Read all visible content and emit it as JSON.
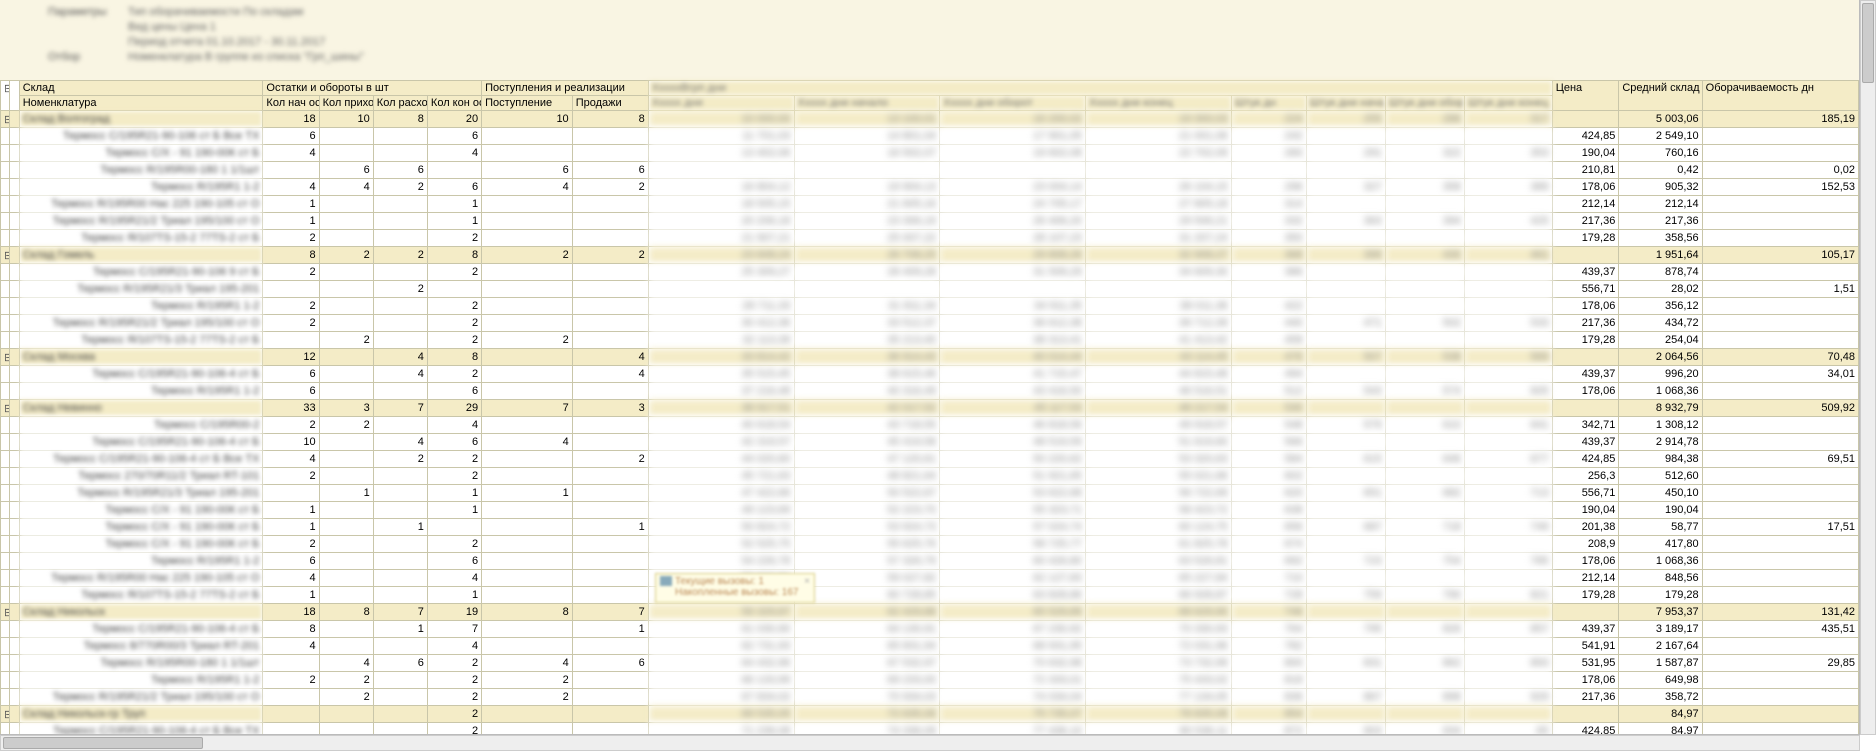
{
  "meta": {
    "p1_label": "Параметры",
    "p1a": "Тип оборачиваемости По складам",
    "p1b": "Вид цены Цена 1",
    "p1c": "Период отчета 01.10.2017 - 30.11.2017",
    "p2_label": "Отбор",
    "p2a": "Номенклатура В группе из списка \"Грп_шины\""
  },
  "headers": {
    "warehouse": "Склад",
    "balances_group": "Остатки и обороты в шт",
    "receipts_group": "Поступления и реализации",
    "blank_group": "XxxxxВгрп дни",
    "price": "Цена",
    "avg_stock": "Средний склад",
    "turnover": "Оборачиваемость дн",
    "nomenclature": "Номенклатура",
    "q_start": "Кол нач ост",
    "q_in": "Кол приход",
    "q_out": "Кол расход",
    "q_end": "Кол кон ост",
    "receipt": "Поступление",
    "sales": "Продажи",
    "bh1": "Xxxxx дни",
    "bh2": "Xxxxx дни начало",
    "bh3": "Xxxxx дни оборот",
    "bh4": "Xxxxx дни конец",
    "bs1": "Штук дн",
    "bs2": "Штук дни начало",
    "bs3": "Штук дни оборот",
    "bs4": "Штук дни конец"
  },
  "popup": {
    "line1": "Текущие вызовы: 1",
    "line2": "Накопленные вызовы: 167"
  },
  "toggle": {
    "open": "⊟",
    "closed": "⊞"
  },
  "rows": [
    {
      "t": "g",
      "tog": "⊟",
      "nom": "Склад Волгоград",
      "q": [
        "18",
        "10",
        "8",
        "20",
        "10",
        "8"
      ],
      "p": "",
      "a": "5 003,06",
      "tn": "185,19"
    },
    {
      "t": "d",
      "nom": "Термосс С/195R21-90-106 ст Б Все ТХ",
      "q": [
        "6",
        "",
        "",
        "6",
        "",
        ""
      ],
      "p": "424,85",
      "a": "2 549,10",
      "tn": ""
    },
    {
      "t": "d",
      "nom": "Термосс С/Х - 91 190-00К ст Б",
      "q": [
        "4",
        "",
        "",
        "4",
        "",
        ""
      ],
      "p": "190,04",
      "a": "760,16",
      "tn": ""
    },
    {
      "t": "d",
      "nom": "Термосс R/195R00-180 1 1/1шт",
      "q": [
        "",
        "6",
        "6",
        "",
        "6",
        "6"
      ],
      "p": "210,81",
      "a": "0,42",
      "tn": "0,02"
    },
    {
      "t": "d",
      "nom": "Термосс R/195R1 1-2",
      "q": [
        "4",
        "4",
        "2",
        "6",
        "4",
        "2"
      ],
      "p": "178,06",
      "a": "905,32",
      "tn": "152,53"
    },
    {
      "t": "d",
      "nom": "Термосс R/195R00 Нас 225 190-105 ст О",
      "q": [
        "1",
        "",
        "",
        "1",
        "",
        ""
      ],
      "p": "212,14",
      "a": "212,14",
      "tn": ""
    },
    {
      "t": "d",
      "nom": "Термосс R/195R21/2 Триал 195/100 ст О",
      "q": [
        "1",
        "",
        "",
        "1",
        "",
        ""
      ],
      "p": "217,36",
      "a": "217,36",
      "tn": ""
    },
    {
      "t": "d",
      "nom": "Термосс Я/107TS-15-2 77TS-2 ст Б",
      "q": [
        "2",
        "",
        "",
        "2",
        "",
        ""
      ],
      "p": "179,28",
      "a": "358,56",
      "tn": ""
    },
    {
      "t": "g",
      "tog": "⊟",
      "nom": "Склад Гомель",
      "q": [
        "8",
        "2",
        "2",
        "8",
        "2",
        "2"
      ],
      "p": "",
      "a": "1 951,64",
      "tn": "105,17"
    },
    {
      "t": "d",
      "nom": "Термосс С/195R21-90-106 9 ст Б",
      "q": [
        "2",
        "",
        "",
        "2",
        "",
        ""
      ],
      "p": "439,37",
      "a": "878,74",
      "tn": ""
    },
    {
      "t": "d",
      "nom": "Термосс R/195R21/3 Триал 195-201",
      "q": [
        "",
        "",
        "2",
        "",
        "",
        ""
      ],
      "p": "556,71",
      "a": "28,02",
      "tn": "1,51"
    },
    {
      "t": "d",
      "nom": "Термосс R/195R1 1-2",
      "q": [
        "2",
        "",
        "",
        "2",
        "",
        ""
      ],
      "p": "178,06",
      "a": "356,12",
      "tn": ""
    },
    {
      "t": "d",
      "nom": "Термосс R/195R21/2 Триал 195/100 ст О",
      "q": [
        "2",
        "",
        "",
        "2",
        "",
        ""
      ],
      "p": "217,36",
      "a": "434,72",
      "tn": ""
    },
    {
      "t": "d",
      "nom": "Термосс Я/107TS-15-2 77TS-2 ст Б",
      "q": [
        "",
        "2",
        "",
        "2",
        "2",
        ""
      ],
      "p": "179,28",
      "a": "254,04",
      "tn": ""
    },
    {
      "t": "g",
      "tog": "⊟",
      "nom": "Склад Москва",
      "q": [
        "12",
        "",
        "4",
        "8",
        "",
        "4"
      ],
      "p": "",
      "a": "2 064,56",
      "tn": "70,48"
    },
    {
      "t": "d",
      "nom": "Термосс С/195R21-90-106-4 ст Б",
      "q": [
        "6",
        "",
        "4",
        "2",
        "",
        "4"
      ],
      "p": "439,37",
      "a": "996,20",
      "tn": "34,01"
    },
    {
      "t": "d",
      "nom": "Термосс R/195R1 1-2",
      "q": [
        "6",
        "",
        "",
        "6",
        "",
        ""
      ],
      "p": "178,06",
      "a": "1 068,36",
      "tn": ""
    },
    {
      "t": "g",
      "tog": "⊟",
      "nom": "Склад Невинно",
      "q": [
        "33",
        "3",
        "7",
        "29",
        "7",
        "3"
      ],
      "p": "",
      "a": "8 932,79",
      "tn": "509,92"
    },
    {
      "t": "d",
      "nom": "Термосс С/195R00-2",
      "q": [
        "2",
        "2",
        "",
        "4",
        "",
        ""
      ],
      "p": "342,71",
      "a": "1 308,12",
      "tn": ""
    },
    {
      "t": "d",
      "nom": "Термосс С/195R21-90-106-4 ст Б",
      "q": [
        "10",
        "",
        "4",
        "6",
        "4",
        ""
      ],
      "p": "439,37",
      "a": "2 914,78",
      "tn": ""
    },
    {
      "t": "d",
      "nom": "Термосс С/195R21-90-106-4 ст Б Все ТХ",
      "q": [
        "4",
        "",
        "2",
        "2",
        "",
        "2"
      ],
      "p": "424,85",
      "a": "984,38",
      "tn": "69,51"
    },
    {
      "t": "d",
      "nom": "Термосс 270/70R11/2 Триал RT-101",
      "q": [
        "2",
        "",
        "",
        "2",
        "",
        ""
      ],
      "p": "256,3",
      "a": "512,60",
      "tn": ""
    },
    {
      "t": "d",
      "nom": "Термосс R/195R21/3 Триал 195-201",
      "q": [
        "",
        "1",
        "",
        "1",
        "1",
        ""
      ],
      "p": "556,71",
      "a": "450,10",
      "tn": ""
    },
    {
      "t": "d",
      "nom": "Термосс С/Х - 91 190-00К ст Б",
      "q": [
        "1",
        "",
        "",
        "1",
        "",
        ""
      ],
      "p": "190,04",
      "a": "190,04",
      "tn": ""
    },
    {
      "t": "d",
      "nom": "Термосс С/Х - 91 190-00К ст Б",
      "q": [
        "1",
        "",
        "1",
        "",
        "",
        "1"
      ],
      "p": "201,38",
      "a": "58,77",
      "tn": "17,51"
    },
    {
      "t": "d",
      "nom": "Термосс С/Х - 91 190-00К ст Б",
      "q": [
        "2",
        "",
        "",
        "2",
        "",
        ""
      ],
      "p": "208,9",
      "a": "417,80",
      "tn": ""
    },
    {
      "t": "d",
      "nom": "Термосс R/195R1 1-2",
      "q": [
        "6",
        "",
        "",
        "6",
        "",
        ""
      ],
      "p": "178,06",
      "a": "1 068,36",
      "tn": ""
    },
    {
      "t": "d",
      "nom": "Термосс R/195R00 Нас 225 190-105 ст О",
      "q": [
        "4",
        "",
        "",
        "4",
        "",
        ""
      ],
      "p": "212,14",
      "a": "848,56",
      "tn": ""
    },
    {
      "t": "d",
      "nom": "Термосс Я/107TS-15-2 77TS-2 ст Б",
      "q": [
        "1",
        "",
        "",
        "1",
        "",
        ""
      ],
      "p": "179,28",
      "a": "179,28",
      "tn": ""
    },
    {
      "t": "g",
      "tog": "⊟",
      "nom": "Склад Никольск",
      "q": [
        "18",
        "8",
        "7",
        "19",
        "8",
        "7"
      ],
      "p": "",
      "a": "7 953,37",
      "tn": "131,42"
    },
    {
      "t": "d",
      "nom": "Термосс С/195R21-90-106-4 ст Б",
      "q": [
        "8",
        "",
        "1",
        "7",
        "",
        "1"
      ],
      "p": "439,37",
      "a": "3 189,17",
      "tn": "435,51"
    },
    {
      "t": "d",
      "nom": "Термосс 8/770R00/3 Триал RT-201",
      "q": [
        "4",
        "",
        "",
        "4",
        "",
        ""
      ],
      "p": "541,91",
      "a": "2 167,64",
      "tn": ""
    },
    {
      "t": "d",
      "nom": "Термосс R/195R00-180 1 1/1шт",
      "q": [
        "",
        "4",
        "6",
        "2",
        "4",
        "6"
      ],
      "p": "531,95",
      "a": "1 587,87",
      "tn": "29,85"
    },
    {
      "t": "d",
      "nom": "Термосс R/195R1 1-2",
      "q": [
        "2",
        "2",
        "",
        "2",
        "2",
        ""
      ],
      "p": "178,06",
      "a": "649,98",
      "tn": ""
    },
    {
      "t": "d",
      "nom": "Термосс R/195R21/2 Триал 195/100 ст О",
      "q": [
        "",
        "2",
        "",
        "2",
        "2",
        ""
      ],
      "p": "217,36",
      "a": "358,72",
      "tn": ""
    },
    {
      "t": "g",
      "tog": "⊟",
      "nom": "Склад Никольск-гр Труп",
      "q": [
        "",
        "",
        "",
        "2",
        "",
        ""
      ],
      "p": "",
      "a": "84,97",
      "tn": ""
    },
    {
      "t": "d",
      "nom": "Термосс С/195R21-90-106-4 ст Б Все ТХ",
      "q": [
        "",
        "",
        "",
        "2",
        "",
        ""
      ],
      "p": "424,85",
      "a": "84,97",
      "tn": ""
    }
  ]
}
